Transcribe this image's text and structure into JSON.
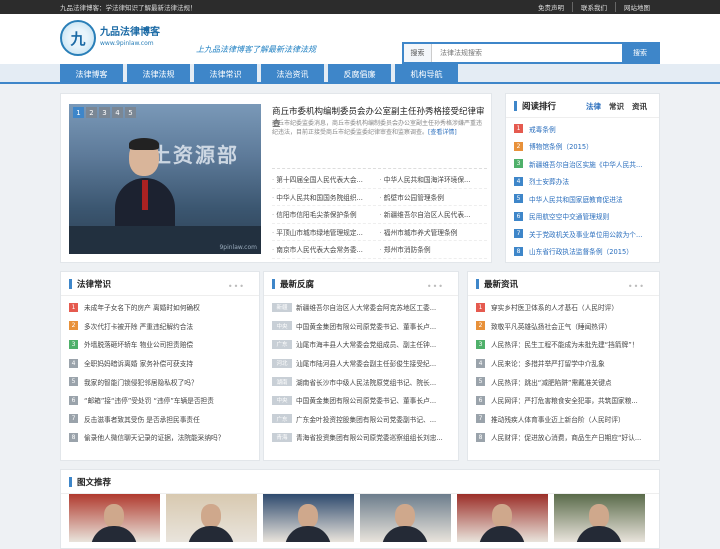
{
  "topbar": {
    "left": "九品法律博客：学法律知识了解最新法律法规！",
    "links": [
      "免责声明",
      "联系我们",
      "网站地图"
    ]
  },
  "logo": {
    "mark": "九",
    "name": "九品法律博客",
    "url": "www.9pinlaw.com"
  },
  "slogan": "上九品法律博客了解最新法律法规",
  "search": {
    "label": "搜索",
    "placeholder": "法律法规搜索",
    "button": "搜索"
  },
  "nav": [
    "法律博客",
    "法律法规",
    "法律常识",
    "法治资讯",
    "反腐倡廉",
    "机构导航"
  ],
  "feature": {
    "slide_nums": [
      "1",
      "2",
      "3",
      "4",
      "5"
    ],
    "banner_text": "国土资源部",
    "watermark": "9pinlaw.com",
    "title": "商丘市委机构编制委员会办公室副主任孙秀格接受纪律审查",
    "summary": "商丘市纪委监委消息，商丘市委机构编制委员会办公室副主任孙秀格涉嫌严重违纪违法，目前正接受商丘市纪委监委纪律审查和监察调查。",
    "more": "[查看详情]",
    "list": [
      [
        "第十四届全国人民代表大会...",
        "中华人民共和国海洋环境保..."
      ],
      [
        "中华人民共和国国务院组织...",
        "鹤壁市公园管理条例"
      ],
      [
        "信阳市信阳毛尖茶保护条例",
        "新疆维吾尔自治区人民代表..."
      ],
      [
        "平顶山市城市绿地管理规定...",
        "福州市城市养犬管理条例"
      ],
      [
        "南京市人民代表大会常务委...",
        "郑州市消防条例"
      ]
    ]
  },
  "rank": {
    "title": "阅读排行",
    "tabs": [
      "法律",
      "常识",
      "资讯"
    ],
    "items": [
      "戒毒条例",
      "博物馆条例（2015）",
      "新疆维吾尔自治区实施《中华人民共...",
      "烈士安葬办法",
      "中华人民共和国家庭教育促进法",
      "民用航空空中交通管理规则",
      "关于党政机关及事业单位用公款为个...",
      "山东省行政执法监督条例（2015）"
    ]
  },
  "columns": [
    {
      "title": "法律常识",
      "items": [
        "未成年子女名下的房产 离婚时如何确权",
        "多次代打卡被开除 严重违纪解约合法",
        "外墙脱落砸坏轿车 物业公司担责赔偿",
        "全职妈妈暗诉离婚 家务补偿可获支持",
        "我家的智能门锁侵犯邻居隐私权了吗？",
        "“邮箱”接“违停”受处罚 “违停”车辆是否担责",
        "反击滋事者致其受伤 是否承担民事责任",
        "偷录他人微信聊天记录的证据，法院能采纳吗？"
      ]
    },
    {
      "title": "最新反腐",
      "tags": [
        "新疆",
        "中央",
        "广东",
        "河北",
        "湖南",
        "中央",
        "广东",
        "青海"
      ],
      "items": [
        "新疆维吾尔自治区人大常委会阿克苏地区工委...",
        "中国黄金集团有限公司原党委书记、董事长卢...",
        "汕尾市海丰县人大常委会党组成员、副主任钟...",
        "汕尾市陆河县人大常委会副主任彭俊生接受纪...",
        "湖南省长沙市中级人民法院原党组书记、院长...",
        "中国黄金集团有限公司原党委书记、董事长卢...",
        "广东金叶投资控股集团有限公司党委副书记、...",
        "青海省投资集团有限公司原党委巡察组组长刘忠..."
      ]
    },
    {
      "title": "最新资讯",
      "items": [
        "穿实乡村医卫体系的人才基石（人民时评）",
        "致敬平凡英雄弘扬社会正气（睡闻热评）",
        "人民热评：民生工程不能成为未批先建“挡箭牌”！",
        "人民来论：多措并举严打留学中介乱象",
        "人民热评：跳出“减肥陷阱”需戴准关键点",
        "人民网评：严打危害粮食安全犯罪，共筑国家粮...",
        "推动残疾人体育事业迈上新台阶（人民时评）",
        "人民财评：促进放心消费，商品生产日期应“好认..."
      ]
    }
  ],
  "pic": {
    "title": "图文推荐",
    "thumb_colors": [
      "#b03a2e",
      "#d8c9b0",
      "#2e4a6e",
      "#6c7d8c",
      "#9b2e28",
      "#5a6b4a",
      "#3b5d8a"
    ]
  },
  "colors": {
    "accent": "#3e86c9",
    "rank_nums": [
      "#e55a4f",
      "#e8913a",
      "#4fb06a",
      "#3e86c9",
      "#3e86c9",
      "#3e86c9",
      "#3e86c9",
      "#3e86c9"
    ],
    "list_nums": [
      "#e55a4f",
      "#e8913a",
      "#4fb06a",
      "#9aa3ab",
      "#9aa3ab",
      "#9aa3ab",
      "#9aa3ab",
      "#9aa3ab"
    ]
  }
}
